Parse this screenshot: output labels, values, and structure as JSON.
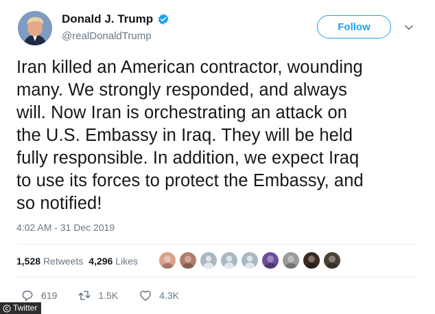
{
  "header": {
    "display_name": "Donald J. Trump",
    "handle": "@realDonaldTrump",
    "follow_label": "Follow"
  },
  "tweet": {
    "lines": [
      "Iran killed an American contractor, wounding",
      "many. We strongly responded, and always",
      "will. Now Iran is orchestrating an attack on",
      "the U.S. Embassy in Iraq. They will be held",
      "fully responsible. In addition, we expect Iraq",
      "to use its forces to protect the Embassy, and",
      "so notified!"
    ],
    "timestamp": "4:02 AM - 31 Dec 2019"
  },
  "stats": {
    "retweets_count": "1,528",
    "retweets_label": "Retweets",
    "likes_count": "4,296",
    "likes_label": "Likes"
  },
  "likers": [
    {
      "icon": "avatar-photo",
      "color": "#d9a08c"
    },
    {
      "icon": "avatar-photo",
      "color": "#b07a6a"
    },
    {
      "icon": "default-avatar",
      "color": "#aab8c2"
    },
    {
      "icon": "default-avatar",
      "color": "#aab8c2"
    },
    {
      "icon": "default-avatar",
      "color": "#aab8c2"
    },
    {
      "icon": "avatar-photo",
      "color": "#6b4c9a"
    },
    {
      "icon": "avatar-photo",
      "color": "#9a9a9a"
    },
    {
      "icon": "avatar-photo",
      "color": "#3a2a20"
    },
    {
      "icon": "avatar-photo",
      "color": "#4a4036"
    }
  ],
  "actions": {
    "replies": "619",
    "retweets": "1.5K",
    "likes": "4.3K"
  },
  "watermark": "Twitter",
  "colors": {
    "accent": "#1da1f2",
    "text": "#14171a",
    "muted": "#657786",
    "divider": "#e6ecf0"
  }
}
